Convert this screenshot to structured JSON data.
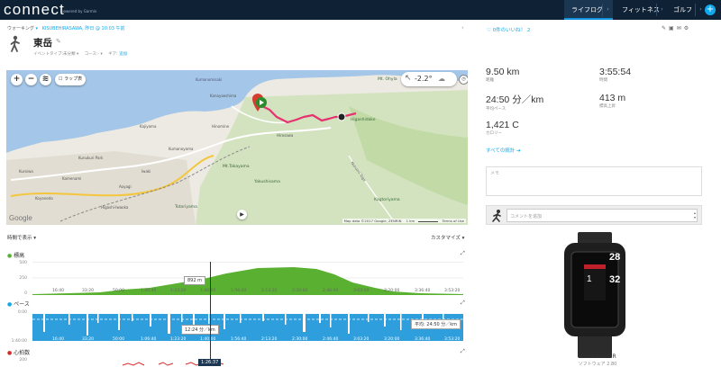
{
  "app": {
    "logo": "connect",
    "logo_sub": "powered by Garmin"
  },
  "nav": {
    "tabs": [
      "ライフログ",
      "フィットネス",
      "ゴルフ"
    ],
    "plus": "+"
  },
  "activity": {
    "type": "ウォーキング",
    "location": "KISUBEHIRASAWA, 昨日 @ 10:03 午前",
    "title": "東岳",
    "event_type": "イベントタイプ:未分類",
    "course": "コース:-",
    "gear": "ギア:",
    "gear_add": "追加",
    "like": "0件のいいね！ 2"
  },
  "map": {
    "temperature": "-2.2°",
    "lap_toggle": "ラップ表",
    "google": "Google",
    "attribution": "Map data ©2017 Google, ZENRIN",
    "scale": "1 km",
    "terms": "Terms of Use",
    "labels": [
      "Mt. Ohyla",
      "Higashidake",
      "Mt.Takayama",
      "Kagtoriyama",
      "Yakushisama",
      "Totoriyama",
      "Kumanomisaki",
      "Kanayaeshima",
      "Kajiyama",
      "Hinomine",
      "Kunukuri Park",
      "Hirosawa",
      "Higashi-Iwaoka",
      "Iwaki",
      "Nonomi-Toge",
      "Kamenami",
      "Aoyagi",
      "Koyaneda",
      "Kuroiwa",
      "Kumanoyama"
    ]
  },
  "stats": [
    {
      "value": "9.50 km",
      "label": "距離"
    },
    {
      "value": "3:55:54",
      "label": "時間"
    },
    {
      "value": "24:50 分／km",
      "label": "平均ペース"
    },
    {
      "value": "413 m",
      "label": "標高上昇"
    },
    {
      "value": "1,421 C",
      "label": "カロリー"
    }
  ],
  "links": {
    "all_stats": "すべての統計"
  },
  "notes": {
    "placeholder": "メモ",
    "comment_placeholder": "コメントを追加"
  },
  "charts": {
    "time_view": "時間で表示 ▾",
    "customize": "カスタマイズ ▾",
    "elevation": {
      "title": "標高",
      "yticks": [
        "500",
        "250",
        "0"
      ],
      "tooltip": "892 m"
    },
    "pace": {
      "title": "ペース",
      "yticks": [
        "0:00",
        "1:40:00"
      ],
      "tooltip": "12:24 分／km",
      "avg": "平均: 24:50 分／km"
    },
    "hr": {
      "title": "心拍数",
      "yticks": [
        "200"
      ],
      "tooltip": "1:26:37"
    },
    "xticks": [
      "16:40",
      "33:20",
      "50:00",
      "1:06:40",
      "1:23:20",
      "1:40:00",
      "1:56:40",
      "2:13:20",
      "2:30:00",
      "2:46:40",
      "3:03:20",
      "3:20:00",
      "3:36:40",
      "3:53:20"
    ]
  },
  "device": {
    "name": "vivoactive HR",
    "sub": "ソフトウェア 2.80",
    "screen_top": "1",
    "screen_mid": "28",
    "screen_bot": "32"
  }
}
